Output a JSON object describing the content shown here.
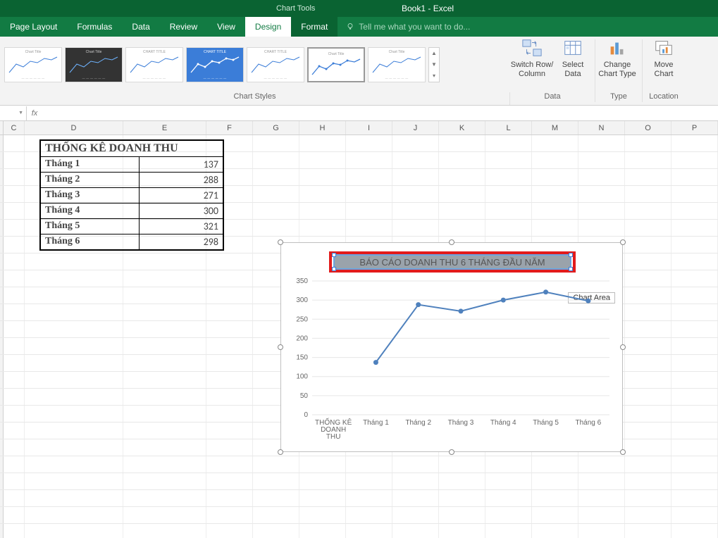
{
  "titlebar": {
    "tool_context": "Chart Tools",
    "doc_title": "Book1 - Excel"
  },
  "tabs": {
    "page_layout": "Page Layout",
    "formulas": "Formulas",
    "data": "Data",
    "review": "Review",
    "view": "View",
    "design": "Design",
    "format": "Format",
    "tell_me": "Tell me what you want to do..."
  },
  "ribbon": {
    "chart_styles_label": "Chart Styles",
    "switch_rowcol": "Switch Row/\nColumn",
    "select_data": "Select\nData",
    "change_chart_type": "Change\nChart Type",
    "move_chart": "Move\nChart",
    "group_data": "Data",
    "group_type": "Type",
    "group_location": "Location"
  },
  "formula_bar": {
    "fx_label": "fx",
    "value": ""
  },
  "columns": [
    "C",
    "D",
    "E",
    "F",
    "G",
    "H",
    "I",
    "J",
    "K",
    "L",
    "M",
    "N",
    "O",
    "P"
  ],
  "data_table": {
    "title": "THỐNG KÊ DOANH THU",
    "rows": [
      {
        "label": "Tháng 1",
        "value": "137"
      },
      {
        "label": "Tháng 2",
        "value": "288"
      },
      {
        "label": "Tháng 3",
        "value": "271"
      },
      {
        "label": "Tháng 4",
        "value": "300"
      },
      {
        "label": "Tháng 5",
        "value": "321"
      },
      {
        "label": "Tháng 6",
        "value": "298"
      }
    ]
  },
  "chart": {
    "title_text": "BÁO CÁO DOANH THU 6 THÁNG ĐẦU NĂM",
    "tooltip": "Chart Area",
    "xcat0": "THỐNG KÊ\nDOANH\nTHU",
    "yticks": [
      "0",
      "50",
      "100",
      "150",
      "200",
      "250",
      "300",
      "350"
    ]
  },
  "chart_data": {
    "type": "line",
    "title": "BÁO CÁO DOANH THU 6 THÁNG ĐẦU NĂM",
    "categories": [
      "THỐNG KÊ DOANH THU",
      "Tháng 1",
      "Tháng 2",
      "Tháng 3",
      "Tháng 4",
      "Tháng 5",
      "Tháng 6"
    ],
    "values": [
      null,
      137,
      288,
      271,
      300,
      321,
      298
    ],
    "ylim": [
      0,
      350
    ],
    "xlabel": "",
    "ylabel": ""
  }
}
